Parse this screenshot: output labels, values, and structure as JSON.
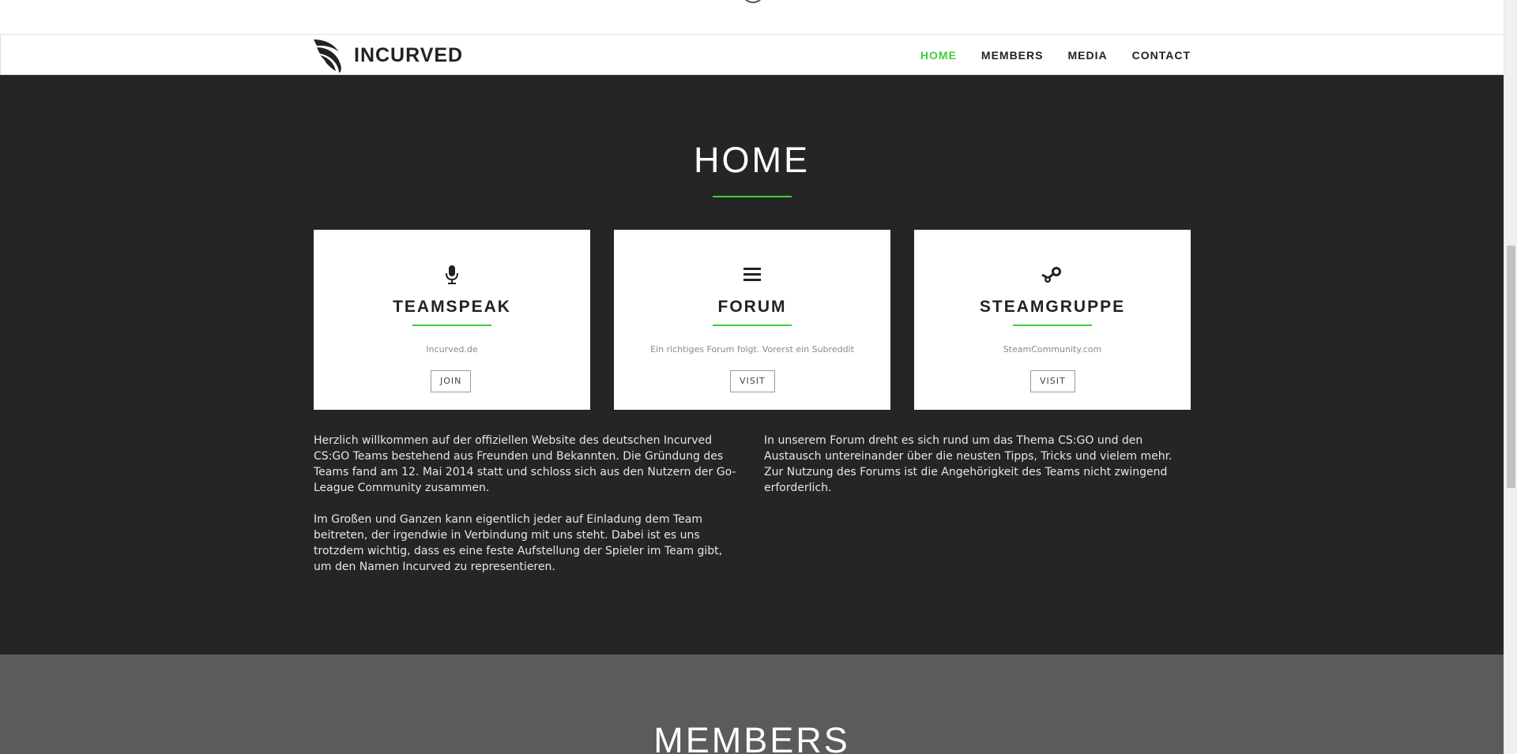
{
  "brand": {
    "name": "INCURVED"
  },
  "nav": {
    "items": [
      {
        "label": "HOME"
      },
      {
        "label": "MEMBERS"
      },
      {
        "label": "MEDIA"
      },
      {
        "label": "CONTACT"
      }
    ],
    "active_index": 0
  },
  "home": {
    "title": "HOME",
    "cards": [
      {
        "icon": "microphone-icon",
        "title": "TEAMSPEAK",
        "subtitle": "Incurved.de",
        "button": "JOIN"
      },
      {
        "icon": "list-icon",
        "title": "FORUM",
        "subtitle": "Ein richtiges Forum folgt. Vorerst ein Subreddit",
        "button": "VISIT"
      },
      {
        "icon": "steam-icon",
        "title": "STEAMGRUPPE",
        "subtitle": "SteamCommunity.com",
        "button": "VISIT"
      }
    ],
    "paragraphs": [
      "Herzlich willkommen auf der offiziellen Website des deutschen Incurved CS:GO Teams bestehend aus Freunden und Bekannten. Die Gründung des Teams fand am 12. Mai 2014 statt und schloss sich aus den Nutzern der Go-League Community zusammen.",
      "Im Großen und Ganzen kann eigentlich jeder auf Einladung dem Team beitreten, der irgendwie in Verbindung mit uns steht. Dabei ist es uns trotzdem wichtig, dass es eine feste Aufstellung der Spieler im Team gibt, um den Namen Incurved zu representieren.",
      "In unserem Forum dreht es sich rund um das Thema CS:GO und den Austausch untereinander über die neusten Tipps, Tricks und vielem mehr. Zur Nutzung des Forums ist die Angehörigkeit des Teams nicht zwingend erforderlich."
    ]
  },
  "members": {
    "title": "MEMBERS"
  },
  "colors": {
    "accent": "#3ed03e",
    "dark_section": "#252525",
    "members_section": "#5b5b5b",
    "card_bg": "#ffffff",
    "nav_text": "#222222"
  }
}
